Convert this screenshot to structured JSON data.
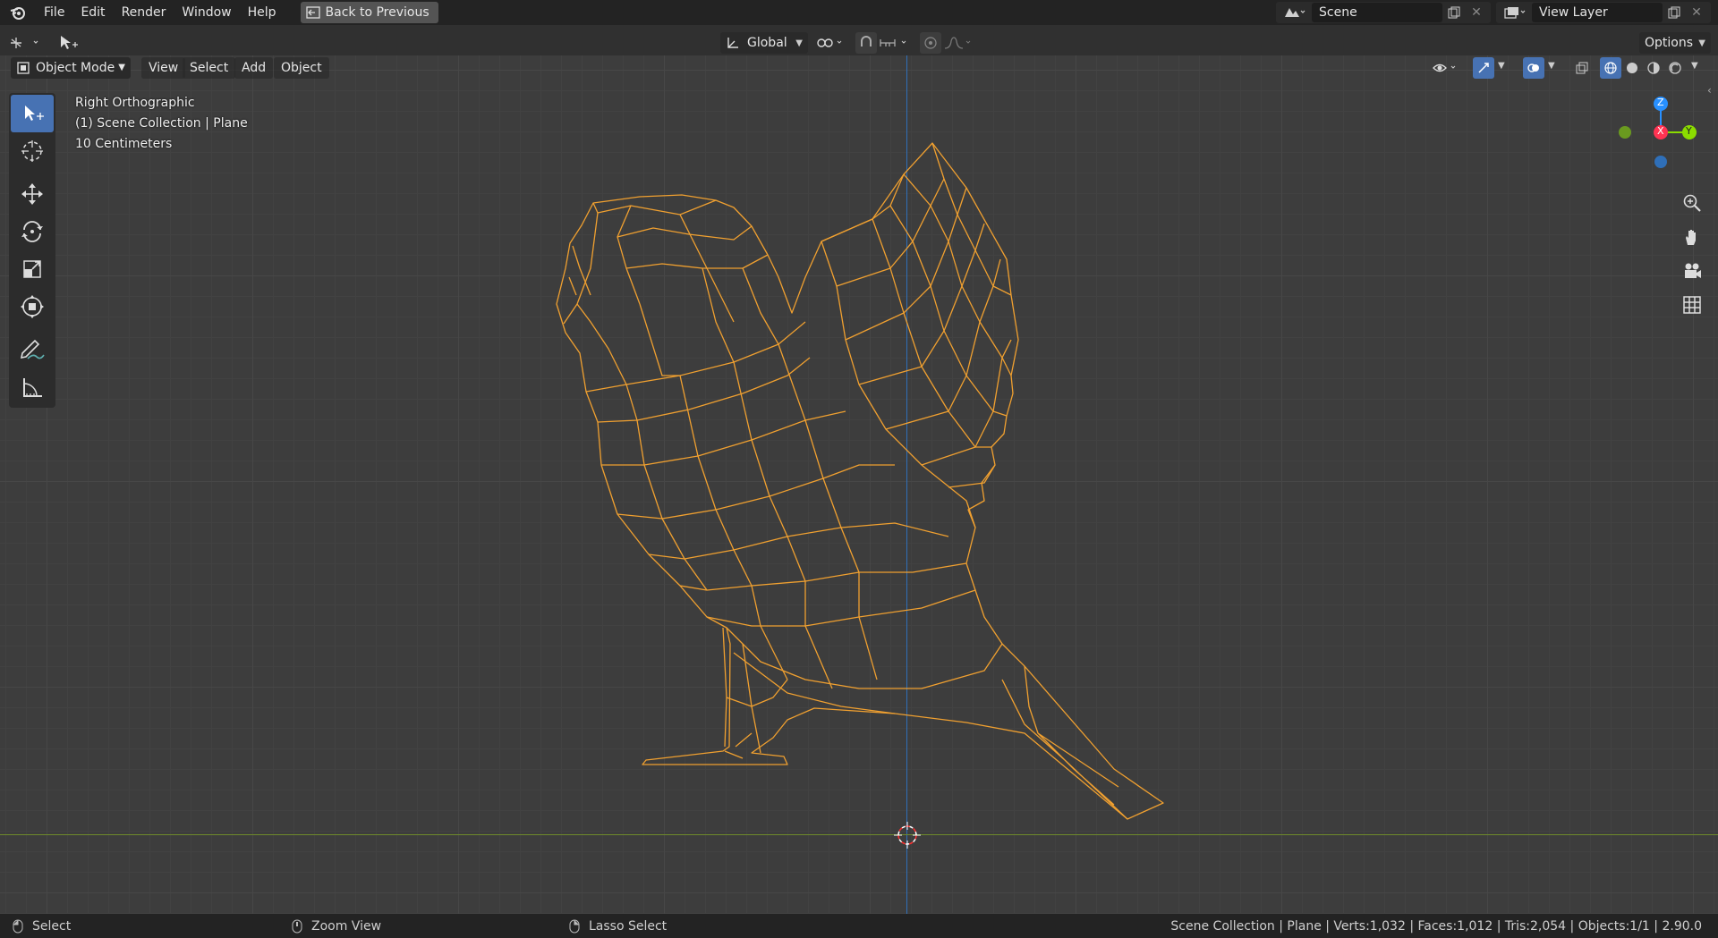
{
  "menu": {
    "file": "File",
    "edit": "Edit",
    "render": "Render",
    "window": "Window",
    "help": "Help",
    "back_to_previous": "Back to Previous"
  },
  "workspace": {
    "scene": "Scene",
    "view_layer": "View Layer"
  },
  "tool_settings": {
    "orientation": "Global",
    "options": "Options"
  },
  "viewport_header": {
    "mode": "Object Mode",
    "view": "View",
    "select": "Select",
    "add": "Add",
    "object": "Object"
  },
  "viewport_info": {
    "view_name": "Right Orthographic",
    "collection": "(1) Scene Collection | Plane",
    "scale": "10 Centimeters"
  },
  "gizmo": {
    "z": "Z",
    "x": "X",
    "y": "Y",
    "colors": {
      "x": "#ff3352",
      "y": "#8bdc00",
      "z": "#2890ff"
    }
  },
  "statusbar": {
    "select": "Select",
    "zoom": "Zoom View",
    "lasso": "Lasso Select",
    "stats": "Scene Collection | Plane | Verts:1,032 | Faces:1,012 | Tris:2,054 | Objects:1/1 | 2.90.0"
  },
  "colors": {
    "wire": "#f0a030",
    "active_tool": "#4772b3",
    "axis_y": "#6e8a2a",
    "axis_z": "#2f6fb8"
  }
}
